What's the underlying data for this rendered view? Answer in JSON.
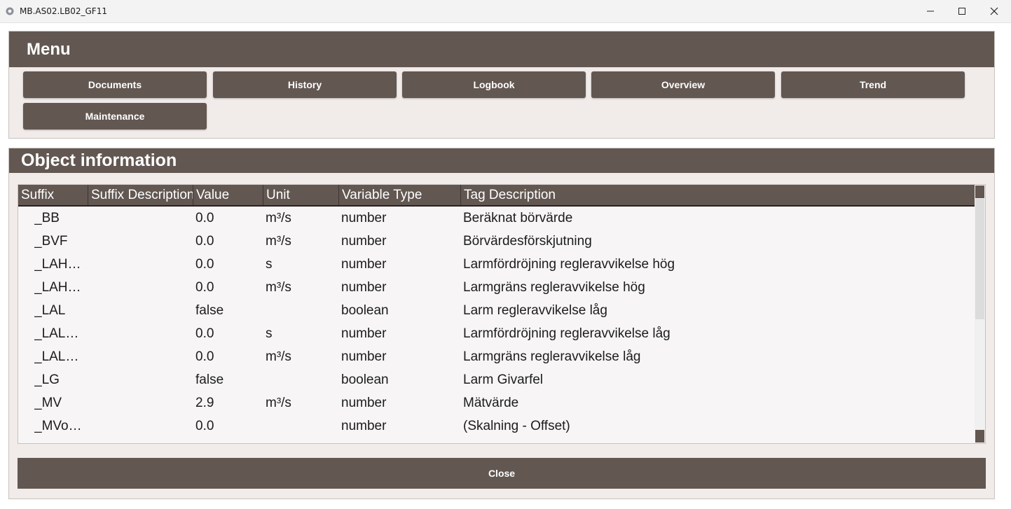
{
  "window": {
    "title": "MB.AS02.LB02_GF11",
    "icon": "gear-app-icon"
  },
  "menu": {
    "title": "Menu",
    "buttons": [
      "Documents",
      "History",
      "Logbook",
      "Overview",
      "Trend",
      "Maintenance"
    ]
  },
  "object_info": {
    "title": "Object information",
    "columns": [
      "Suffix",
      "Suffix Description",
      "Value",
      "Unit",
      "Variable Type",
      "Tag Description"
    ],
    "rows": [
      {
        "suffix": "_BB",
        "suffix_desc": "",
        "value": "0.0",
        "unit": "m³/s",
        "type": "number",
        "desc": "Beräknat börvärde"
      },
      {
        "suffix": "_BVF",
        "suffix_desc": "",
        "value": "0.0",
        "unit": "m³/s",
        "type": "number",
        "desc": "Börvärdesförskjutning"
      },
      {
        "suffix": "_LAH…",
        "suffix_desc": "",
        "value": "0.0",
        "unit": "s",
        "type": "number",
        "desc": "Larmfördröjning regleravvikelse hög"
      },
      {
        "suffix": "_LAH…",
        "suffix_desc": "",
        "value": "0.0",
        "unit": "m³/s",
        "type": "number",
        "desc": "Larmgräns regleravvikelse hög"
      },
      {
        "suffix": "_LAL",
        "suffix_desc": "",
        "value": "false",
        "unit": "",
        "type": "boolean",
        "desc": "Larm regleravvikelse låg"
      },
      {
        "suffix": "_LAL…",
        "suffix_desc": "",
        "value": "0.0",
        "unit": "s",
        "type": "number",
        "desc": "Larmfördröjning regleravvikelse låg"
      },
      {
        "suffix": "_LAL…",
        "suffix_desc": "",
        "value": "0.0",
        "unit": "m³/s",
        "type": "number",
        "desc": "Larmgräns regleravvikelse låg"
      },
      {
        "suffix": "_LG",
        "suffix_desc": "",
        "value": "false",
        "unit": "",
        "type": "boolean",
        "desc": "Larm Givarfel"
      },
      {
        "suffix": "_MV",
        "suffix_desc": "",
        "value": "2.9",
        "unit": "m³/s",
        "type": "number",
        "desc": "Mätvärde"
      },
      {
        "suffix": "_MVo…",
        "suffix_desc": "",
        "value": "0.0",
        "unit": "",
        "type": "number",
        "desc": "(Skalning - Offset)"
      }
    ]
  },
  "close_label": "Close",
  "colors": {
    "header_brown": "#625751",
    "panel_bg": "#f1ebe9",
    "text_white": "#ffffff"
  }
}
